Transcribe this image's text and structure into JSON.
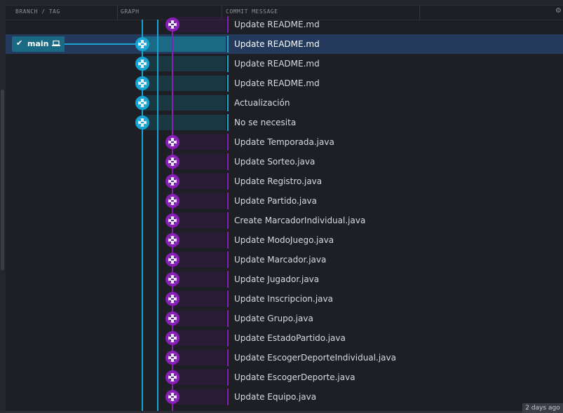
{
  "header": {
    "col_branch": "BRANCH / TAG",
    "col_graph": "GRAPH",
    "col_message": "COMMIT MESSAGE",
    "settings_icon": "gear-icon"
  },
  "branch": {
    "name": "main",
    "check_icon": "check-icon",
    "computer_icon": "laptop-icon"
  },
  "colors": {
    "blue_lane": "#1ba3d4",
    "purple_lane": "#8a1fb8",
    "selected_row": "#233a5c",
    "branch_tag": "#196a82",
    "background": "#1d1f25"
  },
  "commits": [
    {
      "message": "Update README.md",
      "lane": "purple"
    },
    {
      "message": "Update README.md",
      "lane": "blue",
      "selected": true
    },
    {
      "message": "Update README.md",
      "lane": "blue"
    },
    {
      "message": "Update README.md",
      "lane": "blue"
    },
    {
      "message": "Actualización",
      "lane": "blue"
    },
    {
      "message": "No se necesita",
      "lane": "blue"
    },
    {
      "message": "Update Temporada.java",
      "lane": "purple"
    },
    {
      "message": "Update Sorteo.java",
      "lane": "purple"
    },
    {
      "message": "Update Registro.java",
      "lane": "purple"
    },
    {
      "message": "Update Partido.java",
      "lane": "purple"
    },
    {
      "message": "Create MarcadorIndividual.java",
      "lane": "purple"
    },
    {
      "message": "Update ModoJuego.java",
      "lane": "purple"
    },
    {
      "message": "Update Marcador.java",
      "lane": "purple"
    },
    {
      "message": "Update Jugador.java",
      "lane": "purple"
    },
    {
      "message": "Update Inscripcion.java",
      "lane": "purple"
    },
    {
      "message": "Update Grupo.java",
      "lane": "purple"
    },
    {
      "message": "Update EstadoPartido.java",
      "lane": "purple"
    },
    {
      "message": "Update EscogerDeporteIndividual.java",
      "lane": "purple"
    },
    {
      "message": "Update EscogerDeporte.java",
      "lane": "purple"
    },
    {
      "message": "Update Equipo.java",
      "lane": "purple"
    }
  ],
  "footer": {
    "timestamp": "2 days ago"
  }
}
